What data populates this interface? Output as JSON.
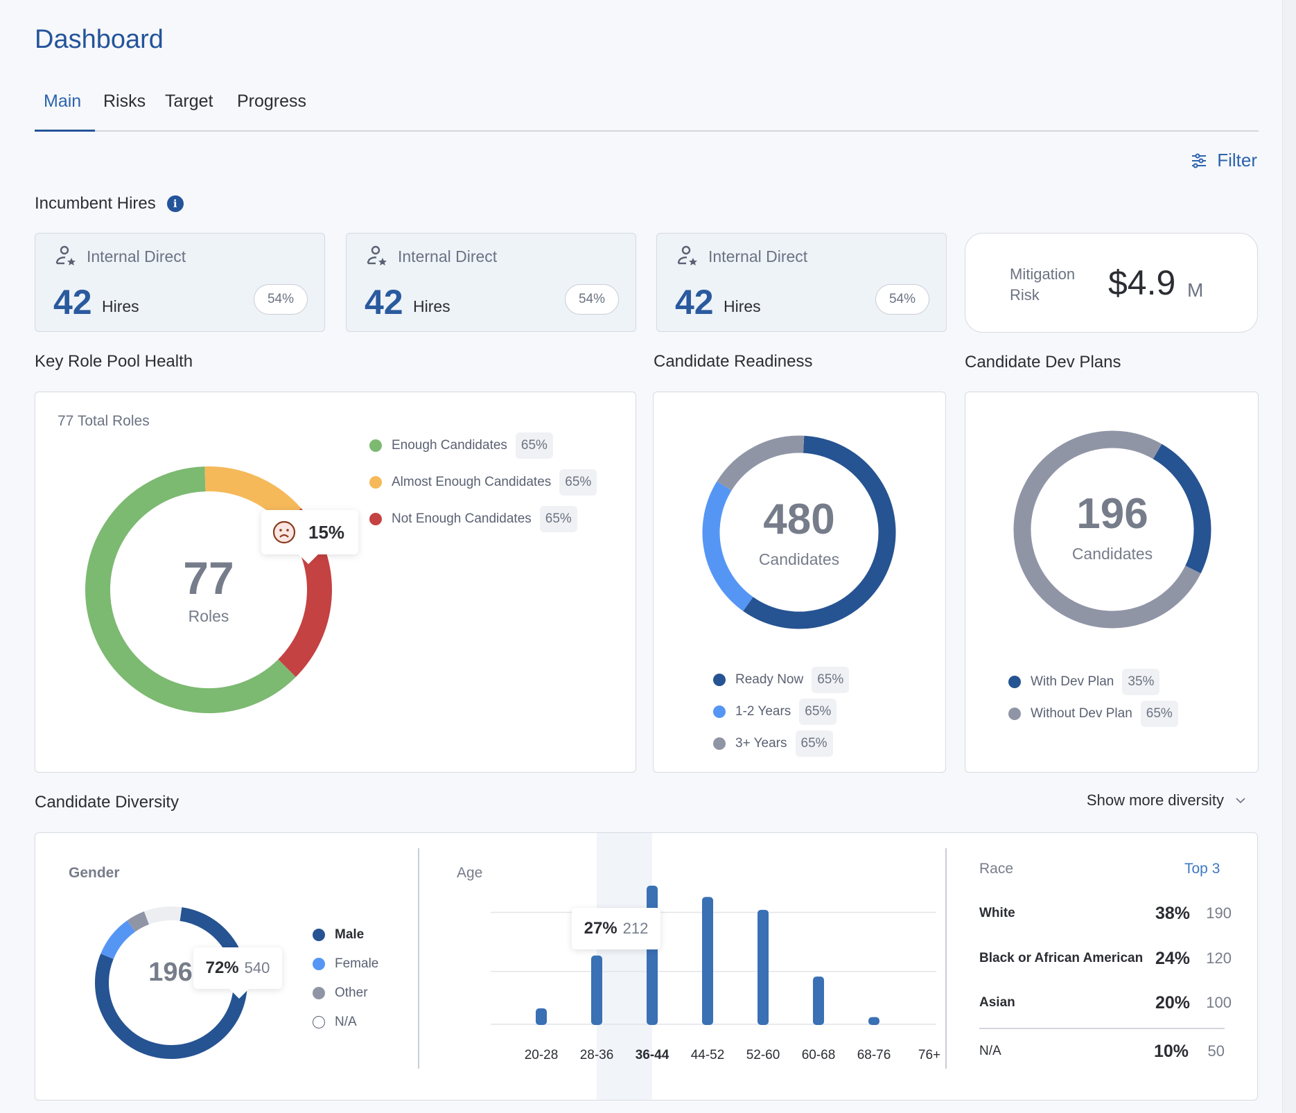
{
  "page": {
    "title": "Dashboard"
  },
  "tabs": [
    {
      "label": "Main",
      "active": true
    },
    {
      "label": "Risks",
      "active": false
    },
    {
      "label": "Target",
      "active": false
    },
    {
      "label": "Progress",
      "active": false
    }
  ],
  "filter": {
    "label": "Filter",
    "icon": "sliders-icon"
  },
  "incumbent_hires": {
    "title": "Incumbent Hires",
    "info_icon": "info-icon",
    "cards": [
      {
        "icon": "person-star-icon",
        "label": "Internal Direct",
        "value": "42",
        "unit": "Hires",
        "percent": "54%"
      },
      {
        "icon": "person-star-icon",
        "label": "Internal Direct",
        "value": "42",
        "unit": "Hires",
        "percent": "54%"
      },
      {
        "icon": "person-star-icon",
        "label": "Internal Direct",
        "value": "42",
        "unit": "Hires",
        "percent": "54%"
      }
    ],
    "mitigation": {
      "label_line1": "Mitigation",
      "label_line2": "Risk",
      "value": "$4.9",
      "unit": "M"
    }
  },
  "key_role_pool": {
    "title": "Key Role Pool Health",
    "total_label": "77 Total Roles",
    "center_value": "77",
    "center_label": "Roles",
    "tooltip": {
      "icon": "sad-face-icon",
      "value": "15%"
    },
    "legend": [
      {
        "label": "Enough Candidates",
        "percent": "65%",
        "color": "#7cb971"
      },
      {
        "label": "Almost Enough Candidates",
        "percent": "65%",
        "color": "#f5b95a"
      },
      {
        "label": "Not Enough Candidates",
        "percent": "65%",
        "color": "#c44242"
      }
    ]
  },
  "candidate_readiness": {
    "title": "Candidate Readiness",
    "center_value": "480",
    "center_label": "Candidates",
    "legend": [
      {
        "label": "Ready Now",
        "percent": "65%",
        "color": "#265392"
      },
      {
        "label": "1-2 Years",
        "percent": "65%",
        "color": "#5596f5"
      },
      {
        "label": "3+ Years",
        "percent": "65%",
        "color": "#9095a6"
      }
    ]
  },
  "candidate_dev_plans": {
    "title": "Candidate Dev Plans",
    "center_value": "196",
    "center_label": "Candidates",
    "legend": [
      {
        "label": "With Dev Plan",
        "percent": "35%",
        "color": "#265392"
      },
      {
        "label": "Without Dev Plan",
        "percent": "65%",
        "color": "#9095a6"
      }
    ]
  },
  "diversity": {
    "title": "Candidate Diversity",
    "show_more_label": "Show more diversity",
    "gender": {
      "title": "Gender",
      "center_value": "196",
      "tooltip": {
        "percent": "72%",
        "count": "540"
      },
      "legend": [
        {
          "label": "Male",
          "color": "#265392",
          "active": true
        },
        {
          "label": "Female",
          "color": "#5596f5",
          "active": false
        },
        {
          "label": "Other",
          "color": "#9095a6",
          "active": false
        },
        {
          "label": "N/A",
          "color": "#ffffff",
          "active": false
        }
      ]
    },
    "age": {
      "title": "Age",
      "tooltip": {
        "percent": "27%",
        "count": "212"
      },
      "highlighted": "36-44"
    },
    "race": {
      "title": "Race",
      "link": "Top 3",
      "rows": [
        {
          "name": "White",
          "percent": "38%",
          "count": "190"
        },
        {
          "name": "Black or African American",
          "percent": "24%",
          "count": "120"
        },
        {
          "name": "Asian",
          "percent": "20%",
          "count": "100"
        }
      ],
      "other": {
        "name": "N/A",
        "percent": "10%",
        "count": "50"
      }
    }
  },
  "chart_data": [
    {
      "type": "pie",
      "title": "Key Role Pool Health",
      "categories": [
        "Enough Candidates",
        "Almost Enough Candidates",
        "Not Enough Candidates"
      ],
      "values": [
        62,
        14,
        24
      ],
      "colors": [
        "#7cb971",
        "#f5b95a",
        "#c44242"
      ],
      "center": "77 Roles"
    },
    {
      "type": "pie",
      "title": "Candidate Readiness",
      "categories": [
        "Ready Now",
        "1-2 Years",
        "3+ Years"
      ],
      "values": [
        59,
        24,
        17
      ],
      "colors": [
        "#265392",
        "#5596f5",
        "#9095a6"
      ],
      "center": "480 Candidates"
    },
    {
      "type": "pie",
      "title": "Candidate Dev Plans",
      "categories": [
        "With Dev Plan",
        "Without Dev Plan"
      ],
      "values": [
        24,
        76
      ],
      "colors": [
        "#265392",
        "#9095a6"
      ],
      "center": "196 Candidates"
    },
    {
      "type": "pie",
      "title": "Gender",
      "categories": [
        "Male",
        "Female",
        "Other",
        "N/A"
      ],
      "values": [
        79,
        9,
        4,
        8
      ],
      "colors": [
        "#265392",
        "#5596f5",
        "#9095a6",
        "#eceef1"
      ],
      "center": "196"
    },
    {
      "type": "bar",
      "title": "Age",
      "categories": [
        "20-28",
        "28-36",
        "36-44",
        "44-52",
        "52-60",
        "60-68",
        "68-76",
        "76+"
      ],
      "values": [
        3.1,
        13.4,
        27,
        24.8,
        22.3,
        9.3,
        1.4,
        0
      ],
      "ylim": [
        0,
        27
      ],
      "grid": true,
      "xlabel": "",
      "ylabel": ""
    }
  ]
}
